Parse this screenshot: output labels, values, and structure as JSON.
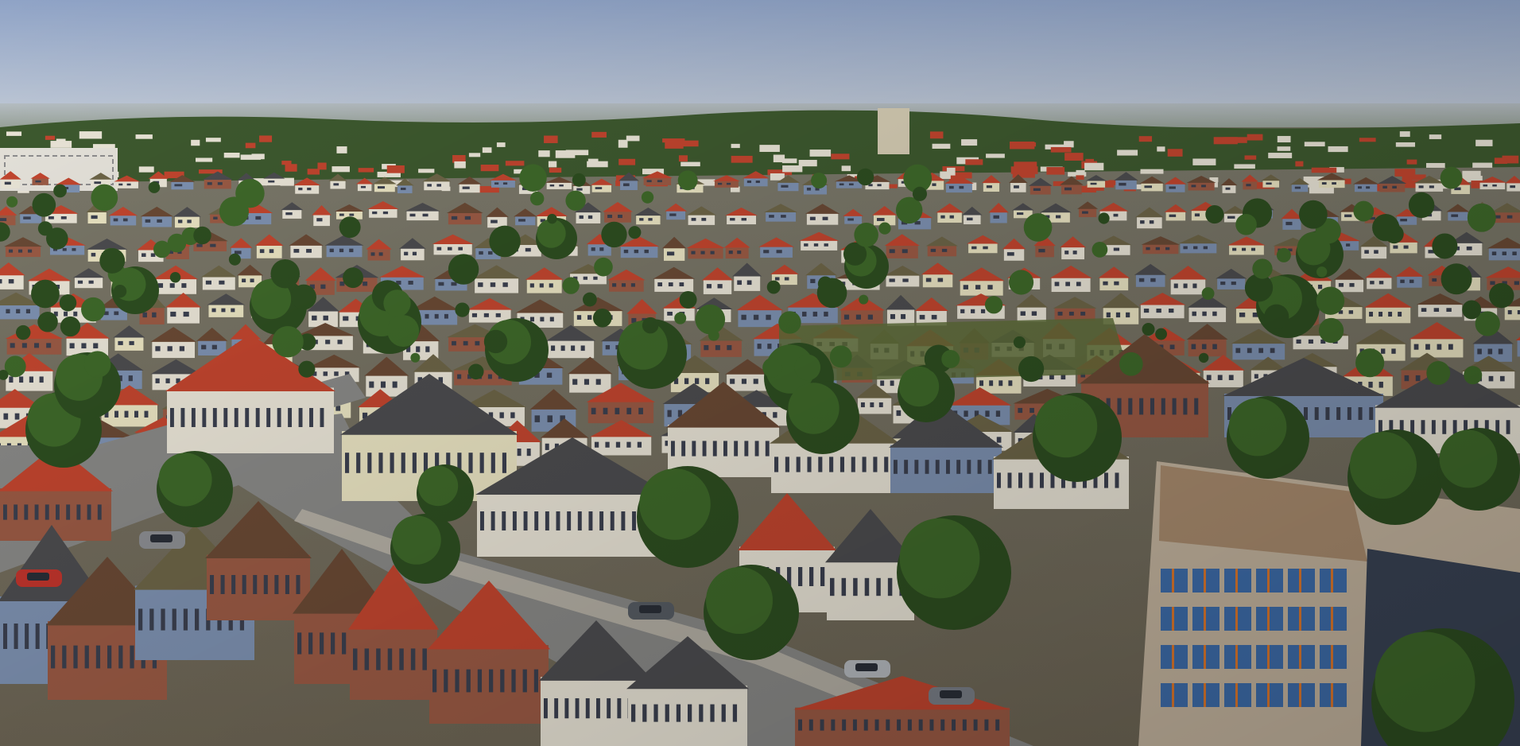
{
  "scene": {
    "kind": "aerial-3d-city-render",
    "palette": {
      "sky_top": "#8fa3c6",
      "sky_bottom": "#c3ccd9",
      "haze": "#a9b2a8",
      "forest": "#3e5a2f",
      "grass": "#5f6f3a",
      "road": "#8a8a88",
      "sidewalk": "#b6b1a6",
      "roof_red": "#c4462f",
      "roof_dark": "#4d4d50",
      "roof_brown": "#6b4a35",
      "roof_olive": "#6e6648",
      "wall_white": "#ece7d9",
      "wall_cream": "#ece6c4",
      "wall_brick": "#9c5b45",
      "wall_blue": "#7f93b3",
      "tree": "#3f6a2a",
      "tree_dark": "#2e4f21",
      "office_facade": "#c8b8a2",
      "office_glass": "#3f6fae",
      "office_accent": "#e07a2e"
    }
  }
}
